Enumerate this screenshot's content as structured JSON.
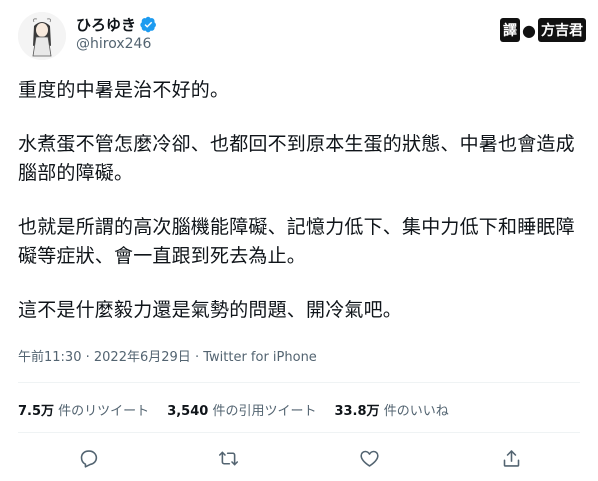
{
  "author": {
    "display_name": "ひろゆき",
    "handle": "@hirox246"
  },
  "translator_badge": {
    "label": "譯",
    "separator": "●",
    "name": "方吉君"
  },
  "tweet": {
    "paragraphs": [
      "重度的中暑是治不好的。",
      "水煮蛋不管怎麼冷卻、也都回不到原本生蛋的狀態、中暑也會造成腦部的障礙。",
      "也就是所謂的高次腦機能障礙、記憶力低下、集中力低下和睡眠障礙等症狀、會一直跟到死去為止。",
      "這不是什麼毅力還是氣勢的問題、開冷氣吧。"
    ],
    "time": "午前11:30",
    "dot1": "·",
    "date": "2022年6月29日",
    "dot2": "·",
    "source": "Twitter for iPhone"
  },
  "stats": {
    "retweets_count": "7.5万",
    "retweets_label": "件のリツイート",
    "quotes_count": "3,540",
    "quotes_label": "件の引用ツイート",
    "likes_count": "33.8万",
    "likes_label": "件のいいね"
  },
  "icons": {
    "reply": "reply-icon",
    "retweet": "retweet-icon",
    "like": "heart-icon",
    "share": "share-icon",
    "verified": "verified-badge-icon"
  },
  "colors": {
    "text": "#0f1419",
    "secondary": "#536471",
    "verified": "#1d9bf0",
    "divider": "#eff3f4"
  }
}
